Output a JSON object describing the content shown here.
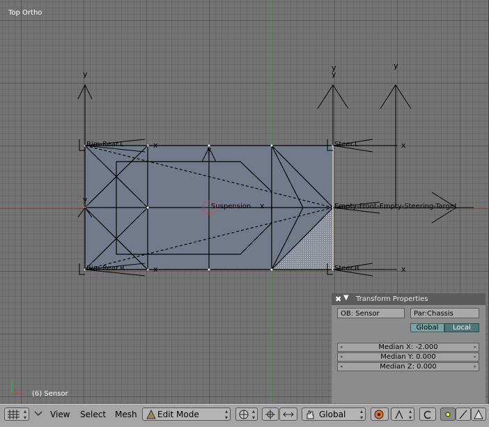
{
  "viewport": {
    "title": "Top Ortho",
    "status": "(6) Sensor",
    "colors": {
      "background": "#737373",
      "mesh_fill": "#717b8c",
      "x_axis": "#b64a4a",
      "y_axis": "#43a843"
    },
    "labels": {
      "rim_rear_l": "Rim-Rear.L",
      "rim_rear_r": "Rim-Rear.R",
      "steer_l": "Steer.L",
      "steer_r": "Steer.R",
      "suspension": "Suspension",
      "empty_front": "Empty-Front-Empty-Steering-Target",
      "axis_y": "y",
      "axis_x": "x"
    }
  },
  "transform_panel": {
    "title": "Transform Properties",
    "close_glyph": "✖",
    "collapse_glyph": "▼",
    "object": "OB: Sensor",
    "parent": "Par:Chassis",
    "global": "Global",
    "local": "Local",
    "median_x": "Median X: -2.000",
    "median_y": "Median Y: 0.000",
    "median_z": "Median Z: 0.000",
    "arrow_left": "◂",
    "arrow_right": "▸"
  },
  "header": {
    "menu_view": "View",
    "menu_select": "Select",
    "menu_mesh": "Mesh",
    "mode": "Edit Mode",
    "orientation": "Global",
    "icons": [
      "editor-type-icon",
      "menu-collapse-icon",
      "edit-mode-icon",
      "draw-type-icon",
      "pivot-icon",
      "transform-manipulator-icon",
      "hand-icon",
      "proportional-edit-icon",
      "snap-icon",
      "undo-icon",
      "vertex-select-icon",
      "edge-select-icon",
      "face-select-icon"
    ]
  }
}
